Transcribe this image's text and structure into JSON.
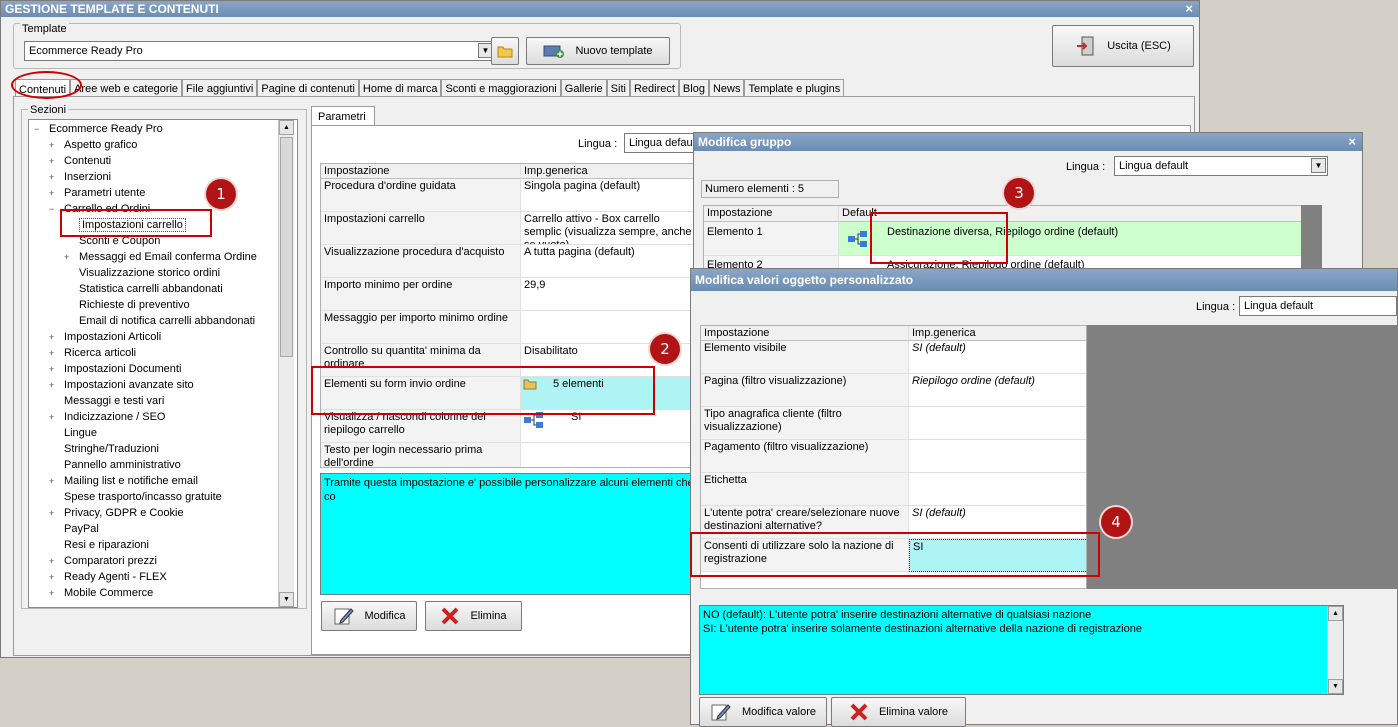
{
  "main_window": {
    "title": "GESTIONE TEMPLATE E CONTENUTI",
    "close_label": "×",
    "template_group_label": "Template",
    "template_value": "Ecommerce Ready Pro",
    "nuovo_template_label": "Nuovo template",
    "uscita_label": "Uscita (ESC)",
    "tabs": [
      {
        "label": "Contenuti"
      },
      {
        "label": "Aree web e categorie"
      },
      {
        "label": "File aggiuntivi"
      },
      {
        "label": "Pagine di contenuti"
      },
      {
        "label": "Home di marca"
      },
      {
        "label": "Sconti e maggiorazioni"
      },
      {
        "label": "Gallerie"
      },
      {
        "label": "Siti"
      },
      {
        "label": "Redirect"
      },
      {
        "label": "Blog"
      },
      {
        "label": "News"
      },
      {
        "label": "Template e plugins"
      }
    ],
    "sezioni_label": "Sezioni",
    "tree": [
      {
        "label": "Ecommerce Ready Pro",
        "exp": "−"
      },
      {
        "label": "Aspetto grafico",
        "exp": "+"
      },
      {
        "label": "Contenuti",
        "exp": "+"
      },
      {
        "label": "Inserzioni",
        "exp": "+"
      },
      {
        "label": "Parametri utente",
        "exp": "+"
      },
      {
        "label": "Carrello ed Ordini",
        "exp": "−"
      },
      {
        "label": "Impostazioni carrello",
        "exp": ""
      },
      {
        "label": "Sconti e Coupon",
        "exp": ""
      },
      {
        "label": "Messaggi ed Email conferma Ordine",
        "exp": "+"
      },
      {
        "label": "Visualizzazione storico ordini",
        "exp": ""
      },
      {
        "label": "Statistica carrelli abbandonati",
        "exp": ""
      },
      {
        "label": "Richieste di preventivo",
        "exp": ""
      },
      {
        "label": "Email di notifica carrelli abbandonati",
        "exp": ""
      },
      {
        "label": "Impostazioni Articoli",
        "exp": "+"
      },
      {
        "label": "Ricerca articoli",
        "exp": "+"
      },
      {
        "label": "Impostazioni Documenti",
        "exp": "+"
      },
      {
        "label": "Impostazioni avanzate sito",
        "exp": "+"
      },
      {
        "label": "Messaggi e testi vari",
        "exp": ""
      },
      {
        "label": "Indicizzazione / SEO",
        "exp": "+"
      },
      {
        "label": "Lingue",
        "exp": ""
      },
      {
        "label": "Stringhe/Traduzioni",
        "exp": ""
      },
      {
        "label": "Pannello amministrativo",
        "exp": ""
      },
      {
        "label": "Mailing list e notifiche email",
        "exp": "+"
      },
      {
        "label": "Spese trasporto/incasso gratuite",
        "exp": ""
      },
      {
        "label": "Privacy, GDPR e Cookie",
        "exp": "+"
      },
      {
        "label": "PayPal",
        "exp": ""
      },
      {
        "label": "Resi e riparazioni",
        "exp": ""
      },
      {
        "label": "Comparatori prezzi",
        "exp": "+"
      },
      {
        "label": "Ready Agenti - FLEX",
        "exp": "+"
      },
      {
        "label": "Mobile Commerce",
        "exp": "+"
      }
    ],
    "parametri_tab": "Parametri",
    "lingua_label": "Lingua :",
    "lingua_value": "Lingua default",
    "grid_headers": {
      "impostazione": "Impostazione",
      "generica": "Imp.generica"
    },
    "grid_rows": [
      {
        "key": "Procedura d'ordine guidata",
        "value": "Singola pagina (default)"
      },
      {
        "key": "Impostazioni carrello",
        "value": "Carrello attivo - Box carrello semplic (visualizza sempre, anche se vuoto)"
      },
      {
        "key": "Visualizzazione procedura d'acquisto",
        "value": "A tutta pagina (default)"
      },
      {
        "key": "Importo minimo per ordine",
        "value": "29,9"
      },
      {
        "key": "Messaggio per importo minimo ordine",
        "value": ""
      },
      {
        "key": "Controllo su quantita' minima da ordinare",
        "value": "Disabilitato"
      },
      {
        "key": "Elementi su form invio ordine",
        "value": "5 elementi"
      },
      {
        "key": "Visualizza / nascondi colonne del riepilogo carrello",
        "value": "SI"
      },
      {
        "key": "Testo per login necessario prima dell'ordine",
        "value": ""
      }
    ],
    "description": "Tramite questa impostazione e' possibile personalizzare alcuni elementi che co",
    "modifica_label": "Modifica",
    "elimina_label": "Elimina"
  },
  "gruppo_window": {
    "title": "Modifica gruppo",
    "close_label": "×",
    "lingua_label": "Lingua :",
    "lingua_value": "Lingua default",
    "numero_elementi": "Numero elementi : 5",
    "headers": {
      "impostazione": "Impostazione",
      "default": "Default"
    },
    "rows": [
      {
        "key": "Elemento 1",
        "value": "Destinazione diversa, Riepilogo ordine (default)"
      },
      {
        "key": "Elemento 2",
        "value": "Assicurazione, Riepilogo ordine (default)"
      }
    ]
  },
  "oggetto_window": {
    "title": "Modifica valori oggetto personalizzato",
    "lingua_label": "Lingua :",
    "lingua_value": "Lingua default",
    "headers": {
      "impostazione": "Impostazione",
      "generica": "Imp.generica"
    },
    "rows": [
      {
        "key": "Elemento visibile",
        "value": "SI (default)"
      },
      {
        "key": "Pagina (filtro visualizzazione)",
        "value": "Riepilogo ordine (default)"
      },
      {
        "key": "Tipo anagrafica cliente (filtro visualizzazione)",
        "value": ""
      },
      {
        "key": "Pagamento (filtro visualizzazione)",
        "value": ""
      },
      {
        "key": "Etichetta",
        "value": ""
      },
      {
        "key": "L'utente potra' creare/selezionare nuove destinazioni alternative?",
        "value": "SI (default)"
      },
      {
        "key": "Consenti di utilizzare solo la nazione di registrazione",
        "value": "SI"
      }
    ],
    "description_line1": "NO (default): L'utente potra' inserire destinazioni alternative di qualsiasi nazione",
    "description_line2": "SI: L'utente potra' inserire solamente destinazioni alternative della nazione di registrazione",
    "modifica_valore_label": "Modifica valore",
    "elimina_valore_label": "Elimina valore"
  },
  "annotations": {
    "badge1": "1",
    "badge2": "2",
    "badge3": "3",
    "badge4": "4"
  },
  "colors": {
    "title_bar": "#6b8cb3",
    "highlight_cyan": "#00ffff",
    "annotation_red": "#d00000",
    "row_green": "#ccffcc"
  }
}
